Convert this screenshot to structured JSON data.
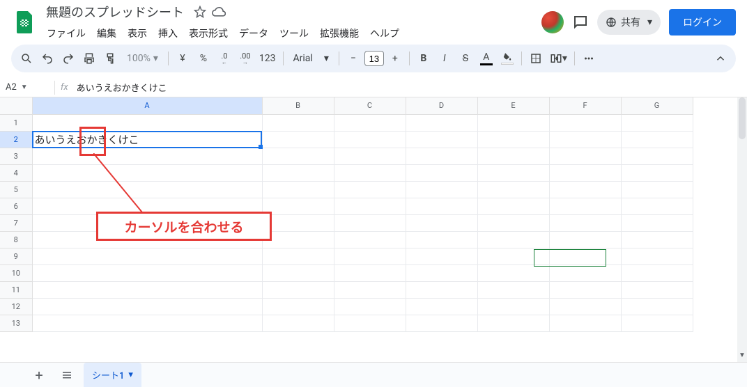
{
  "header": {
    "doc_title": "無題のスプレッドシート",
    "menus": [
      "ファイル",
      "編集",
      "表示",
      "挿入",
      "表示形式",
      "データ",
      "ツール",
      "拡張機能",
      "ヘルプ"
    ],
    "share_label": "共有",
    "login_label": "ログイン"
  },
  "toolbar": {
    "zoom": "100%",
    "currency": "¥",
    "percent": "%",
    "dec_less": ".0",
    "dec_more": ".00",
    "num_format": "123",
    "font": "Arial",
    "font_size": "13"
  },
  "formula": {
    "name_box": "A2",
    "fx": "fx",
    "value": "あいうえおかきくけこ"
  },
  "grid": {
    "columns": [
      "A",
      "B",
      "C",
      "D",
      "E",
      "F",
      "G"
    ],
    "rows": [
      1,
      2,
      3,
      4,
      5,
      6,
      7,
      8,
      9,
      10,
      11,
      12,
      13
    ],
    "a2_value": "あいうえおかきくけこ",
    "selected_col": "A",
    "selected_row": 2
  },
  "annotation": {
    "label": "カーソルを合わせる"
  },
  "sheets": {
    "active": "シート1"
  }
}
